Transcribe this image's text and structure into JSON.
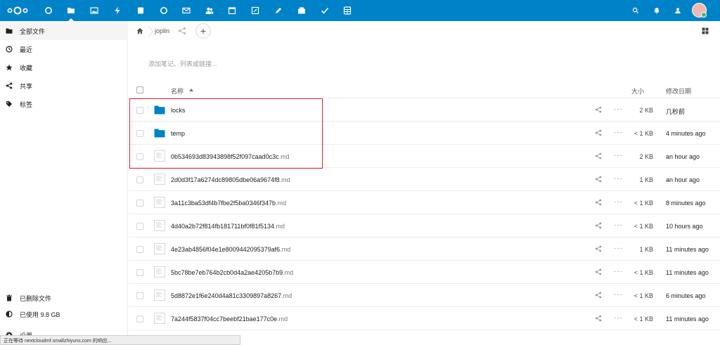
{
  "colors": {
    "header": "#0082c9",
    "highlight": "#e0262b"
  },
  "header": {
    "logo": "nextcloud-logo",
    "apps": [
      "dashboard-icon",
      "files-icon",
      "photos-icon",
      "activity-icon",
      "deck-icon",
      "talk-icon",
      "mail-icon",
      "contacts-icon",
      "calendar-icon",
      "notes-icon",
      "edit-icon",
      "bookmarks-icon",
      "tasks-icon",
      "spreadsheet-icon"
    ],
    "right": [
      "search-icon",
      "notifications-icon",
      "contacts-menu-icon",
      "avatar"
    ]
  },
  "sidebar": {
    "items": [
      {
        "label": "全部文件",
        "icon": "folder-icon"
      },
      {
        "label": "最近",
        "icon": "clock-icon"
      },
      {
        "label": "收藏",
        "icon": "star-icon"
      },
      {
        "label": "共享",
        "icon": "share-icon"
      },
      {
        "label": "标签",
        "icon": "tag-icon"
      }
    ],
    "bottom": [
      {
        "label": "已删除文件",
        "icon": "trash-icon"
      },
      {
        "label": "已使用 9.8 GB",
        "icon": "quota-icon"
      },
      {
        "label": "设置",
        "icon": "gear-icon"
      }
    ]
  },
  "statusbar": {
    "text": "正在等待 nextcloudmf.smallzhiyuns.com 的响应..."
  },
  "breadcrumb": {
    "folder": "joplin"
  },
  "description": {
    "placeholder": "添加笔记、列表或链接..."
  },
  "table": {
    "headers": {
      "name": "名称",
      "size": "大小",
      "modified": "修改日期"
    },
    "rows": [
      {
        "name": "locks",
        "ext": "",
        "type": "folder",
        "size": "2 KB",
        "modified": "几秒前"
      },
      {
        "name": "temp",
        "ext": "",
        "type": "folder",
        "size": "< 1 KB",
        "modified": "4 minutes ago"
      },
      {
        "name": "0b534693d83943898f52f097caad0c3c",
        "ext": ".md",
        "type": "file",
        "size": "2 KB",
        "modified": "an hour ago"
      },
      {
        "name": "2d0d3f17a6274dc89805dbe06a9674f8",
        "ext": ".md",
        "type": "file",
        "size": "1 KB",
        "modified": "an hour ago"
      },
      {
        "name": "3a11c3ba53df4b7fbe2f5ba0346f347b",
        "ext": ".md",
        "type": "file",
        "size": "< 1 KB",
        "modified": "8 minutes ago"
      },
      {
        "name": "4d40a2b72f814fb181711bf0f81f5134",
        "ext": ".md",
        "type": "file",
        "size": "< 1 KB",
        "modified": "10 hours ago"
      },
      {
        "name": "4e23ab4856f04e1e8009442095379af6",
        "ext": ".md",
        "type": "file",
        "size": "1 KB",
        "modified": "11 minutes ago"
      },
      {
        "name": "5bc78be7eb764b2cb0d4a2ae4205b7b9",
        "ext": ".md",
        "type": "file",
        "size": "< 1 KB",
        "modified": "11 minutes ago"
      },
      {
        "name": "5d8872e1f6e240d4a81c3309897a8267",
        "ext": ".md",
        "type": "file",
        "size": "< 1 KB",
        "modified": "6 minutes ago"
      },
      {
        "name": "7a244f5837f04cc7beebf21bae177c0e",
        "ext": ".md",
        "type": "file",
        "size": "< 1 KB",
        "modified": "11 minutes ago"
      }
    ]
  }
}
